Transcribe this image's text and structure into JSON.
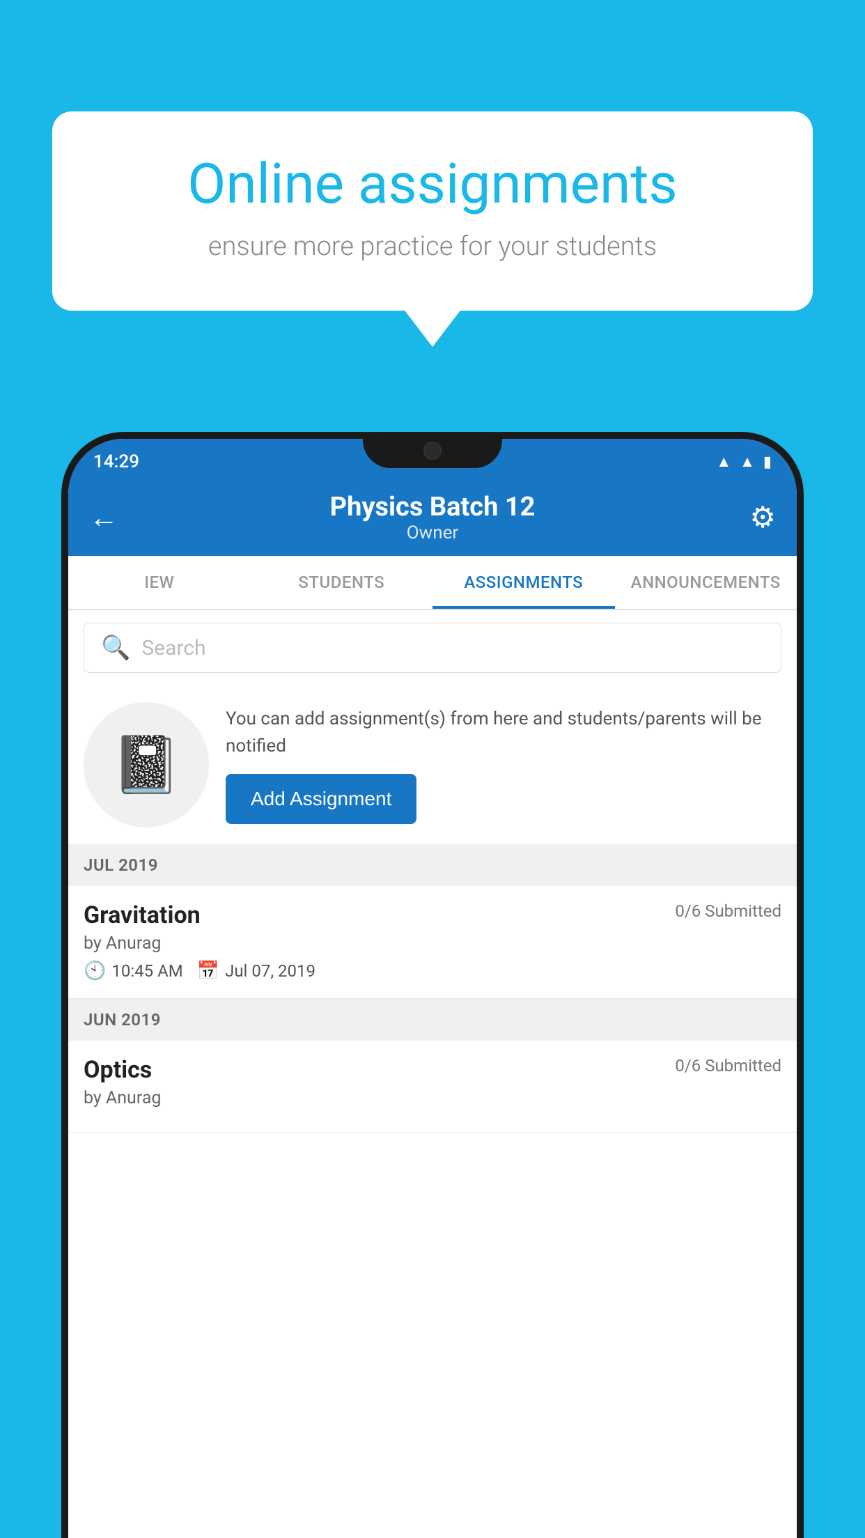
{
  "background_color": "#1ab8e8",
  "speech_bubble": {
    "title": "Online assignments",
    "subtitle": "ensure more practice for your students"
  },
  "phone": {
    "status_bar": {
      "time": "14:29",
      "icons": [
        "wifi",
        "signal",
        "battery"
      ]
    },
    "header": {
      "title": "Physics Batch 12",
      "subtitle": "Owner",
      "back_label": "←",
      "settings_label": "⚙"
    },
    "tabs": [
      {
        "label": "IEW",
        "active": false
      },
      {
        "label": "STUDENTS",
        "active": false
      },
      {
        "label": "ASSIGNMENTS",
        "active": true
      },
      {
        "label": "ANNOUNCEMENTS",
        "active": false
      }
    ],
    "search": {
      "placeholder": "Search"
    },
    "promo": {
      "description": "You can add assignment(s) from here and students/parents will be notified",
      "button_label": "Add Assignment"
    },
    "sections": [
      {
        "month": "JUL 2019",
        "assignments": [
          {
            "title": "Gravitation",
            "submitted": "0/6 Submitted",
            "author": "by Anurag",
            "time": "10:45 AM",
            "date": "Jul 07, 2019"
          }
        ]
      },
      {
        "month": "JUN 2019",
        "assignments": [
          {
            "title": "Optics",
            "submitted": "0/6 Submitted",
            "author": "by Anurag",
            "time": "",
            "date": ""
          }
        ]
      }
    ]
  }
}
